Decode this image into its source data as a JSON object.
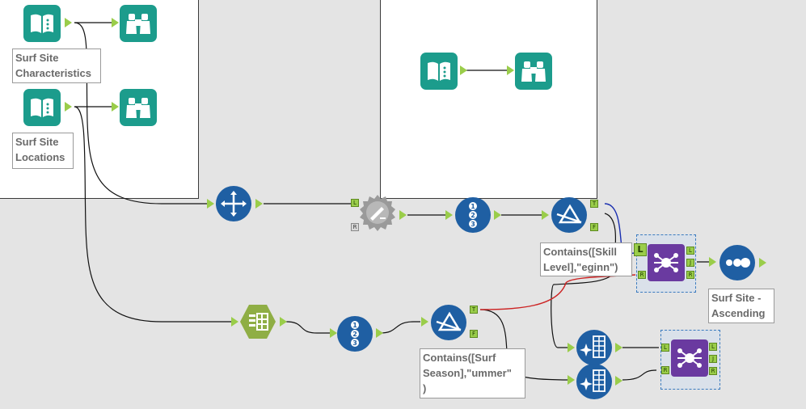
{
  "labels": {
    "surf_site_characteristics": "Surf Site\nCharacteristics",
    "surf_site_locations": "Surf Site\nLocations",
    "filter_skill": "Contains([Skill\nLevel],\"eginn\")",
    "filter_season": "Contains([Surf\nSeason],\"ummer\"\n)",
    "output_ascending": "Surf Site -\nAscending"
  },
  "anchors": {
    "left": "L",
    "right": "R",
    "join": "J",
    "true": "T",
    "false": "F"
  },
  "icons": {
    "input": "book-input-icon",
    "browse": "binoculars-icon",
    "select": "select-crosshair-icon",
    "join": "join-hub-icon",
    "sort": "numbered-sort-icon",
    "filter": "filter-triangle-icon",
    "text_to_columns": "table-columns-icon",
    "formula": "sparkle-table-icon",
    "output": "ellipsis-output-icon",
    "disabled_tool": "gear-pen-icon"
  },
  "colors": {
    "canvas": "#e4e4e4",
    "input_tool": "#1c9c8c",
    "blue_tool": "#1f5fa3",
    "join_tool": "#6a3aa0",
    "tc_tool": "#8fae45",
    "disabled_tool": "#9a9a9a",
    "anchor": "#9acd4a",
    "red_wire": "#cc2222",
    "blue_wire": "#1a2fb0"
  }
}
